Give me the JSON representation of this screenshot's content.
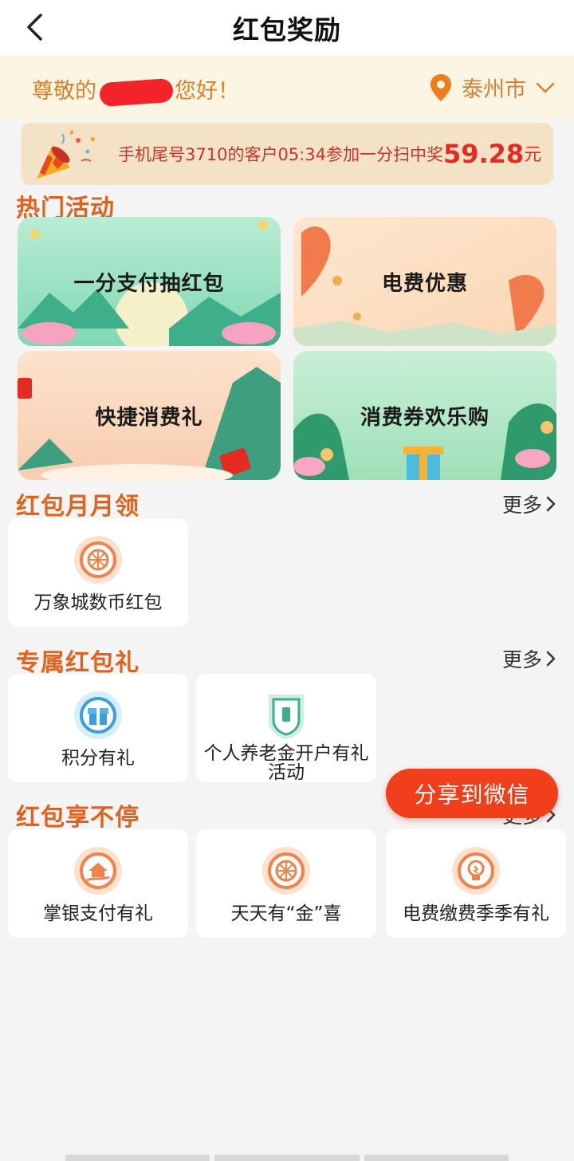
{
  "header": {
    "title": "红包奖励"
  },
  "greeting": {
    "prefix": "尊敬的",
    "suffix": "您好！",
    "city": "泰州市"
  },
  "ticker": {
    "message": "手机尾号3710的客户05:34参加一分扫中奖",
    "amount": "59.28",
    "unit": "元"
  },
  "hot": {
    "title": "热门活动",
    "banners": [
      {
        "label": "一分支付抽红包"
      },
      {
        "label": "电费优惠"
      },
      {
        "label": "快捷消费礼"
      },
      {
        "label": "消费券欢乐购"
      }
    ]
  },
  "monthly": {
    "title": "红包月月领",
    "more": "更多",
    "items": [
      {
        "label": "万象城数币红包"
      }
    ]
  },
  "exclusive": {
    "title": "专属红包礼",
    "more": "更多",
    "items": [
      {
        "label": "积分有礼"
      },
      {
        "label_line1": "个人养老金开户有礼",
        "label_line2": "活动"
      }
    ]
  },
  "nonstop": {
    "title": "红包享不停",
    "more": "更多",
    "items": [
      {
        "label": "掌银支付有礼"
      },
      {
        "label": "天天有“金”喜"
      },
      {
        "label": "电费缴费季季有礼"
      }
    ]
  },
  "share": {
    "label": "分享到微信"
  },
  "colors": {
    "accent": "#e0621d",
    "share": "#f23f1b",
    "amount": "#e52a22"
  }
}
